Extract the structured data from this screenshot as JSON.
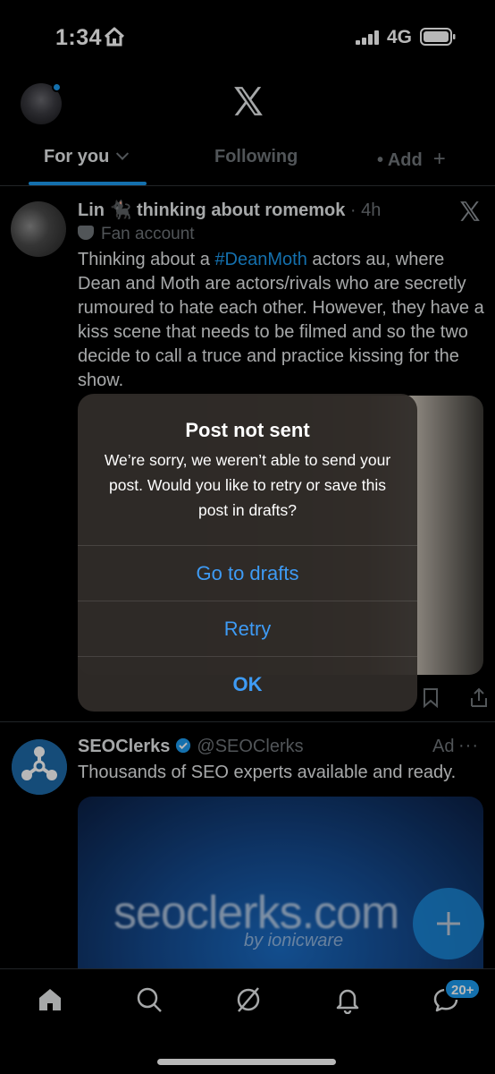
{
  "status": {
    "time": "1:34",
    "network": "4G"
  },
  "header": {
    "tabs": [
      "For you",
      "Following",
      "Add"
    ]
  },
  "post1": {
    "author": "Lin 🐈‍⬛ thinking about romemok",
    "time": "4h",
    "subtitle": "Fan account",
    "text_before": "Thinking about a ",
    "hashtag": "#DeanMoth",
    "text_after": " actors au, where Dean and Moth are actors/rivals who are secretly rumoured to hate each other. However, they have a kiss scene that needs to be filmed and so the two decide to call a truce and practice kissing for the show."
  },
  "post2": {
    "name": "SEOClerks",
    "handle": "@SEOClerks",
    "ad_label": "Ad",
    "text": "Thousands of SEO experts available and ready.",
    "image_text": "seoclerks.com",
    "image_subtext": "by ionicware"
  },
  "bottom_nav": {
    "messages_badge": "20+"
  },
  "dialog": {
    "title": "Post not sent",
    "message": "We’re sorry, we weren’t able to send your post. Would you like to retry or save this post in drafts?",
    "buttons": {
      "drafts": "Go to drafts",
      "retry": "Retry",
      "ok": "OK"
    }
  },
  "colors": {
    "accent": "#1d9bf0",
    "dialog_button": "#3e9bf5",
    "background": "#000000"
  }
}
